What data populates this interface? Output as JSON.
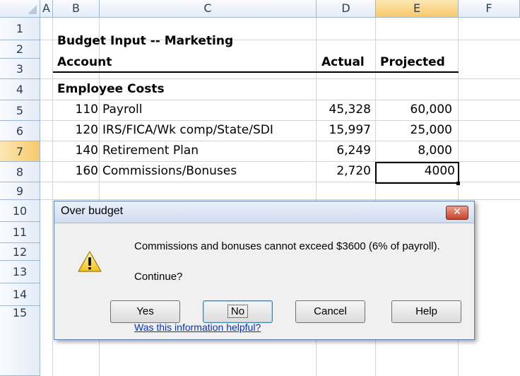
{
  "spreadsheet": {
    "columns": [
      "A",
      "B",
      "C",
      "D",
      "E",
      "F"
    ],
    "selected_column": "E",
    "rows": [
      "1",
      "2",
      "3",
      "4",
      "5",
      "6",
      "7",
      "8",
      "9",
      "10",
      "11",
      "12",
      "13",
      "14",
      "15"
    ],
    "selected_row": "7",
    "cells": {
      "title": "Budget Input -- Marketing",
      "account_header": "Account",
      "actual_header": "Actual",
      "projected_header": "Projected",
      "section": "Employee Costs",
      "lines": [
        {
          "code": "110",
          "name": "Payroll",
          "actual": "45,328",
          "projected": "60,000"
        },
        {
          "code": "120",
          "name": "IRS/FICA/Wk comp/State/SDI",
          "actual": "15,997",
          "projected": "25,000"
        },
        {
          "code": "140",
          "name": "Retirement Plan",
          "actual": "6,249",
          "projected": "8,000"
        },
        {
          "code": "160",
          "name": "Commissions/Bonuses",
          "actual": "2,720",
          "projected": "4000"
        }
      ]
    }
  },
  "dialog": {
    "title": "Over budget",
    "close_glyph": "✕",
    "message": "Commissions and bonuses cannot exceed $3600 (6% of payroll).",
    "prompt": "Continue?",
    "buttons": {
      "yes": "Yes",
      "no": "No",
      "cancel": "Cancel",
      "help": "Help"
    },
    "link": "Was this information helpful?",
    "icon": "warning-icon"
  },
  "colors": {
    "header_selected": "#f8c96a",
    "dialog_border": "#5a7fb4",
    "link": "#0033cc"
  }
}
